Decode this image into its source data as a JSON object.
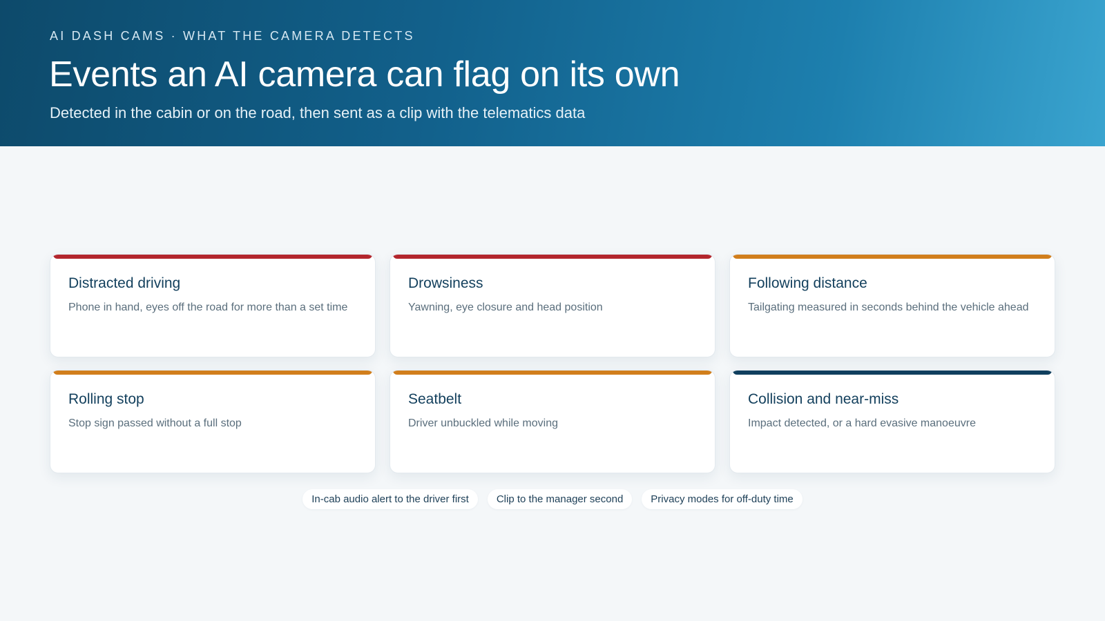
{
  "header": {
    "eyebrow": "AI DASH CAMS · WHAT THE CAMERA DETECTS",
    "title": "Events an AI camera can flag on its own",
    "subtitle": "Detected in the cabin or on the road, then sent as a clip with the telematics data"
  },
  "colors": {
    "critical": "#b3262d",
    "warning": "#d17e1c",
    "severe": "#103f5e"
  },
  "events": [
    {
      "title": "Distracted driving",
      "description": "Phone in hand, eyes off the road for more than a set time",
      "severity": "critical"
    },
    {
      "title": "Drowsiness",
      "description": "Yawning, eye closure and head position",
      "severity": "critical"
    },
    {
      "title": "Following distance",
      "description": "Tailgating measured in seconds behind the vehicle ahead",
      "severity": "warning"
    },
    {
      "title": "Rolling stop",
      "description": "Stop sign passed without a full stop",
      "severity": "warning"
    },
    {
      "title": "Seatbelt",
      "description": "Driver unbuckled while moving",
      "severity": "warning"
    },
    {
      "title": "Collision and near-miss",
      "description": "Impact detected, or a hard evasive manoeuvre",
      "severity": "severe"
    }
  ],
  "pills": [
    "In-cab audio alert to the driver first",
    "Clip to the manager second",
    "Privacy modes for off-duty time"
  ]
}
